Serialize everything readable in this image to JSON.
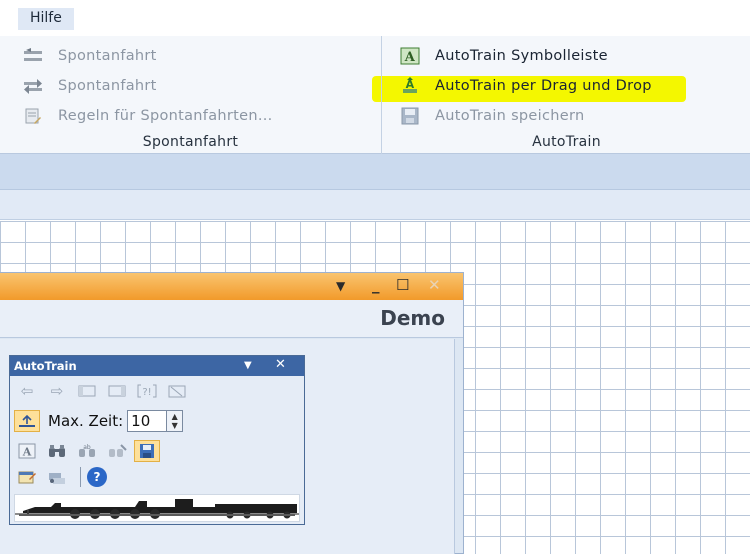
{
  "menu": {
    "help_label": "Hilfe"
  },
  "ribbon": {
    "spontanfahrt_group": {
      "label": "Spontanfahrt",
      "items": [
        {
          "label": "Spontanfahrt",
          "icon": "switch-track-icon",
          "enabled": false
        },
        {
          "label": "Spontanfahrt",
          "icon": "switch-arrows-icon",
          "enabled": false
        },
        {
          "label": "Regeln für Spontanfahrten...",
          "icon": "rules-document-icon",
          "enabled": false
        }
      ]
    },
    "autotrain_group": {
      "label": "AutoTrain",
      "items": [
        {
          "label": "AutoTrain Symbolleiste",
          "icon": "autotrain-a-icon",
          "enabled": true,
          "highlighted": true
        },
        {
          "label": "AutoTrain per Drag und Drop",
          "icon": "drag-drop-icon",
          "enabled": true
        },
        {
          "label": "AutoTrain speichern",
          "icon": "save-disk-icon",
          "enabled": false
        }
      ]
    }
  },
  "window": {
    "header_text": "Demo"
  },
  "toolwindow": {
    "title": "AutoTrain",
    "max_time_label": "Max. Zeit:",
    "max_time_value": "10"
  },
  "colors": {
    "highlight": "#f4f700",
    "titlebar_orange": "#f29a2a",
    "toolwindow_title": "#3d66a4"
  }
}
